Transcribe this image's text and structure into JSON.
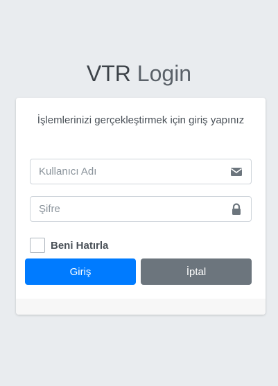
{
  "header": {
    "title_bold": "VTR",
    "title_light": "Login"
  },
  "form": {
    "subtitle": "İşlemlerinizi gerçekleştirmek için giriş yapınız",
    "username_placeholder": "Kullanıcı Adı",
    "username_value": "",
    "username_icon": "envelope-icon",
    "password_placeholder": "Şifre",
    "password_value": "",
    "password_icon": "lock-icon",
    "remember_label": "Beni Hatırla",
    "remember_checked": false,
    "login_label": "Giriş",
    "cancel_label": "İptal"
  },
  "colors": {
    "background": "#e9ecef",
    "primary": "#007bff",
    "secondary": "#6c757d"
  }
}
